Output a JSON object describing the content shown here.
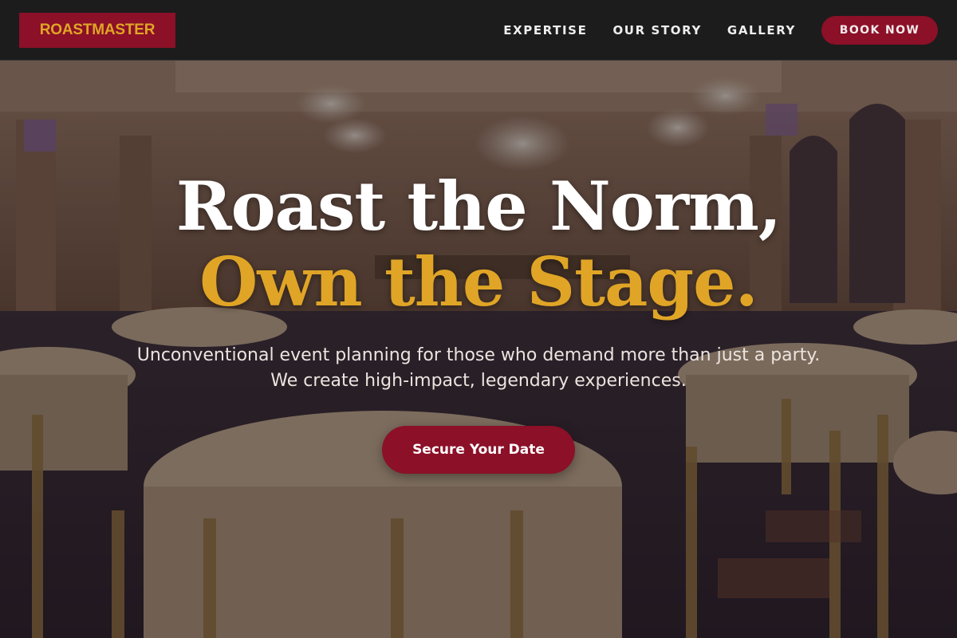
{
  "brand": {
    "logo_text": "ROASTMASTER"
  },
  "nav": {
    "links": [
      "EXPERTISE",
      "OUR STORY",
      "GALLERY"
    ],
    "cta": "BOOK NOW"
  },
  "hero": {
    "headline_line1": "Roast the Norm,",
    "headline_line2": "Own the Stage.",
    "subtitle": "Unconventional event planning for those who demand more than just a party. We create high-impact, legendary experiences.",
    "cta": "Secure Your Date",
    "background": "ballroom-photo"
  },
  "colors": {
    "brand_red": "#8b1028",
    "accent_gold": "#e0a526",
    "navbar_bg": "#1c1c1c"
  }
}
